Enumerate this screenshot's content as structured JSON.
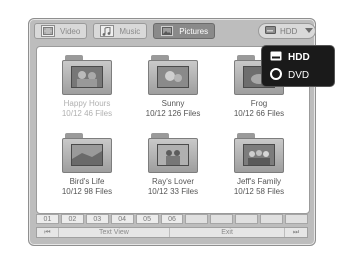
{
  "tabs": [
    {
      "label": "Video",
      "icon": "video-icon",
      "active": false
    },
    {
      "label": "Music",
      "icon": "music-icon",
      "active": false
    },
    {
      "label": "Pictures",
      "icon": "pictures-icon",
      "active": true
    }
  ],
  "source": {
    "label": "HDD",
    "icon": "hdd-icon",
    "chevron": "chevron-down-icon"
  },
  "folders": [
    {
      "name": "Happy Hours",
      "count": "10/12 46 Files",
      "dimmed": true
    },
    {
      "name": "Sunny",
      "count": "10/12 126 Files",
      "dimmed": false
    },
    {
      "name": "Frog",
      "count": "10/12 66 Files",
      "dimmed": false
    },
    {
      "name": "Bird's Life",
      "count": "10/12 98 Files",
      "dimmed": false
    },
    {
      "name": "Ray's Lover",
      "count": "10/12 33 Files",
      "dimmed": false
    },
    {
      "name": "Jeff's Family",
      "count": "10/12 58 Files",
      "dimmed": false
    }
  ],
  "pages": [
    "01",
    "02",
    "03",
    "04",
    "05",
    "06"
  ],
  "bottombar": {
    "prev": "⏮",
    "view": "Text View",
    "exit": "Exit",
    "next": "⏭"
  },
  "dropdown": {
    "items": [
      {
        "label": "HDD",
        "icon": "hdd-icon"
      },
      {
        "label": "DVD",
        "icon": "dvd-icon"
      }
    ]
  },
  "colors": {
    "frame": "#bdbdbd",
    "active_tab": "#8a8a8a",
    "dropdown_bg": "#1a1a1a"
  }
}
